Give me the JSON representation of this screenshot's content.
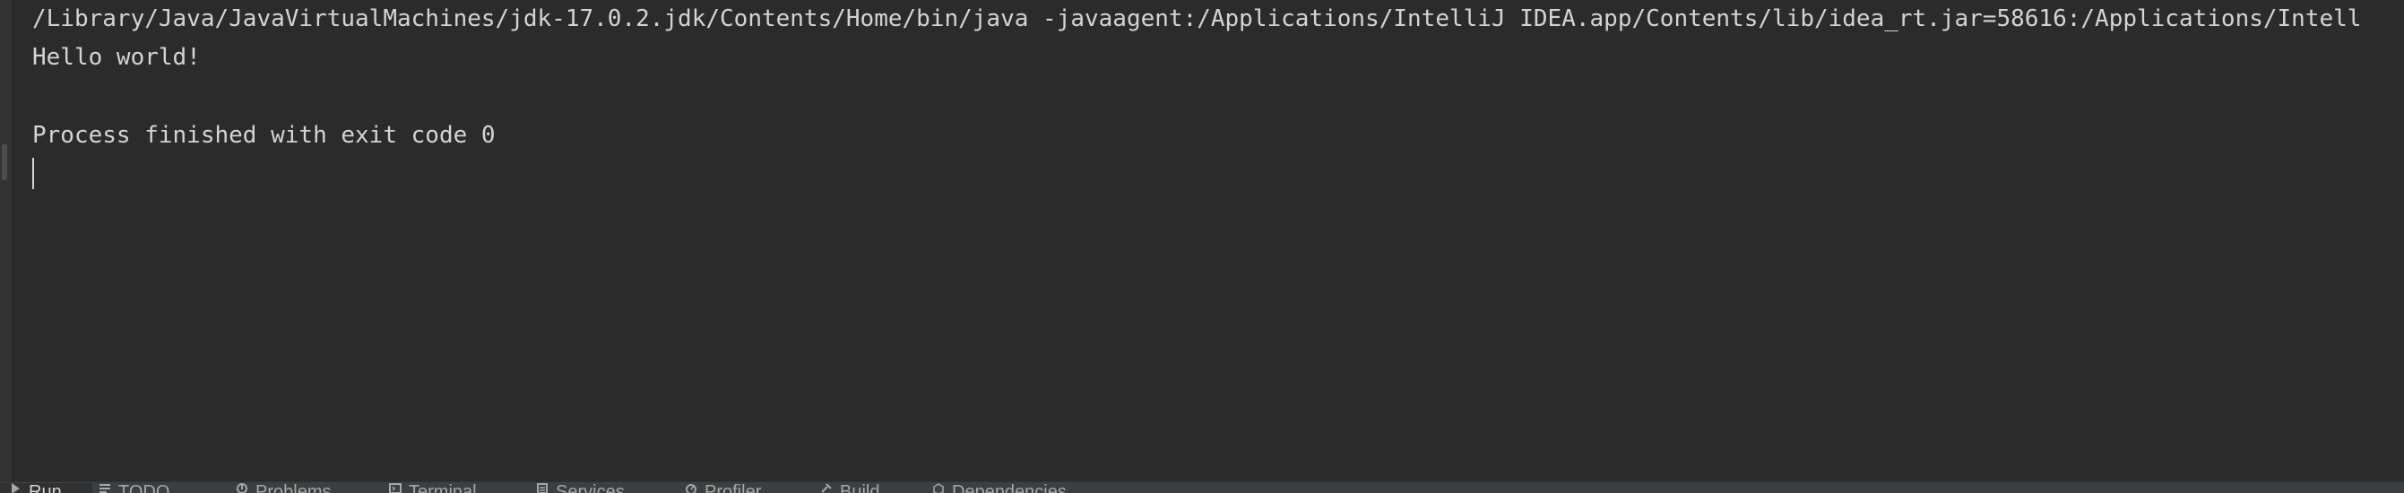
{
  "console": {
    "lines": [
      "/Library/Java/JavaVirtualMachines/jdk-17.0.2.jdk/Contents/Home/bin/java -javaagent:/Applications/IntelliJ IDEA.app/Contents/lib/idea_rt.jar=58616:/Applications/Intell",
      "Hello world!",
      "",
      "Process finished with exit code 0"
    ]
  },
  "tool_strip": {
    "items": [
      {
        "label": "Run",
        "icon": "run-icon"
      },
      {
        "label": "TODO",
        "icon": "todo-icon"
      },
      {
        "label": "Problems",
        "icon": "problems-icon"
      },
      {
        "label": "Terminal",
        "icon": "terminal-icon"
      },
      {
        "label": "Services",
        "icon": "services-icon"
      },
      {
        "label": "Profiler",
        "icon": "profiler-icon"
      },
      {
        "label": "Build",
        "icon": "build-icon"
      },
      {
        "label": "Dependencies",
        "icon": "dependencies-icon"
      }
    ]
  },
  "colors": {
    "console_background": "#2b2b2b",
    "console_text": "#d4d4d4",
    "tool_strip_background": "#3c3f41"
  }
}
